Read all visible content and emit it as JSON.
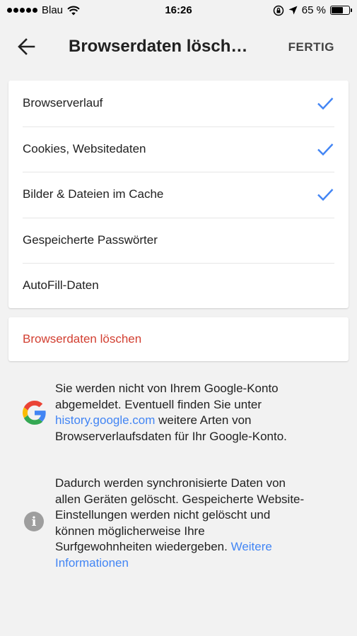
{
  "status_bar": {
    "carrier": "Blau",
    "time": "16:26",
    "battery_percent_label": "65 %",
    "battery_level": 0.65
  },
  "app_bar": {
    "title": "Browserdaten lösch…",
    "done_label": "FERTIG"
  },
  "options": [
    {
      "label": "Browserverlauf",
      "checked": true
    },
    {
      "label": "Cookies, Websitedaten",
      "checked": true
    },
    {
      "label": "Bilder & Dateien im Cache",
      "checked": true
    },
    {
      "label": "Gespeicherte Passwörter",
      "checked": false
    },
    {
      "label": "AutoFill-Daten",
      "checked": false
    }
  ],
  "clear_button_label": "Browserdaten löschen",
  "google_info": {
    "line1": "Sie werden nicht von Ihrem Google-Konto",
    "line2": "abgemeldet. Eventuell finden Sie unter",
    "link": "history.google.com",
    "line3_rest": " weitere Arten von",
    "line4": "Browserverlaufsdaten für Ihr Google-Konto."
  },
  "sync_info": {
    "line1": "Dadurch werden synchronisierte Daten von",
    "line2": "allen Geräten gelöscht. Gespeicherte Website-",
    "line3": "Einstellungen werden nicht gelöscht und",
    "line4": "können möglicherweise Ihre",
    "line5": "Surfgewohnheiten wiedergeben. ",
    "link_part1": "Weitere",
    "link_part2": "Informationen"
  },
  "colors": {
    "accent_blue": "#4285f4",
    "danger_red": "#d23f31",
    "background": "#f2f2f2"
  },
  "icons": [
    "back-arrow-icon",
    "wifi-icon",
    "rotation-lock-icon",
    "location-arrow-icon",
    "battery-icon",
    "check-icon",
    "google-logo-icon",
    "info-icon"
  ]
}
